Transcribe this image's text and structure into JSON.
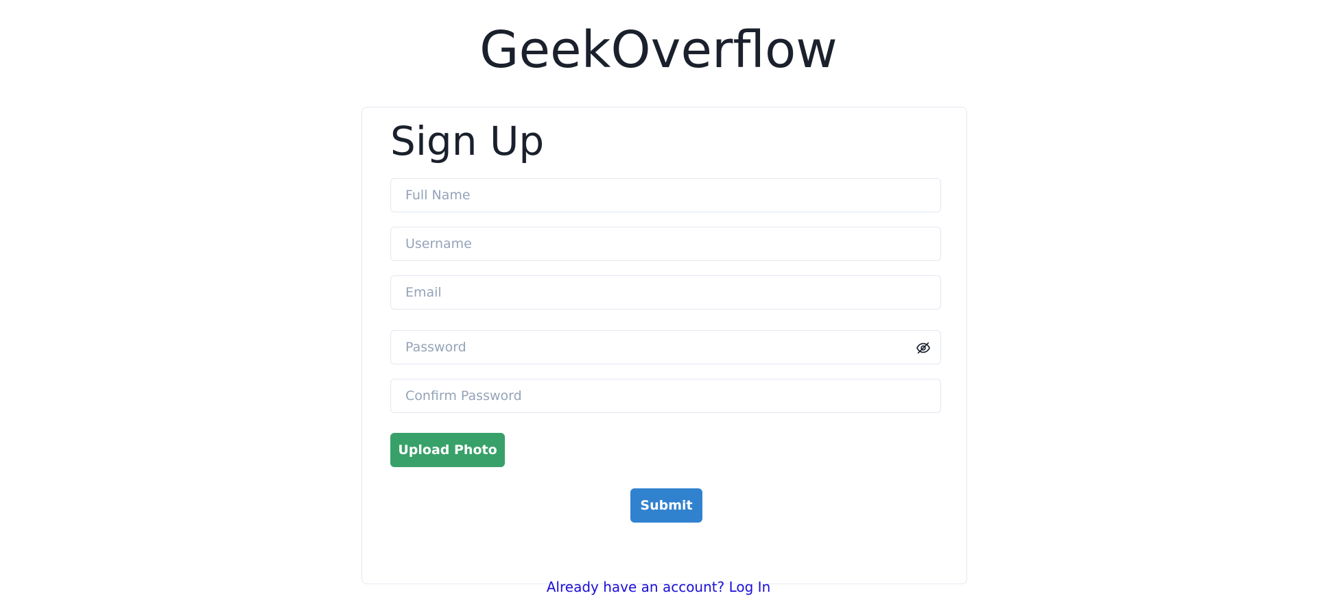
{
  "header": {
    "brand": "GeekOverflow"
  },
  "form": {
    "title": "Sign Up",
    "fields": {
      "full_name": {
        "placeholder": "Full Name",
        "value": ""
      },
      "username": {
        "placeholder": "Username",
        "value": ""
      },
      "email": {
        "placeholder": "Email",
        "value": ""
      },
      "password": {
        "placeholder": "Password",
        "value": ""
      },
      "confirm_password": {
        "placeholder": "Confirm Password",
        "value": ""
      }
    },
    "password_toggle_icon": "eye-off-icon",
    "upload_label": "Upload Photo",
    "submit_label": "Submit"
  },
  "footer": {
    "login_link": "Already have an account? Log In"
  },
  "colors": {
    "upload_button": "#38a169",
    "submit_button": "#3182ce",
    "link": "#1a0dd6",
    "text": "#1a202c",
    "placeholder": "#94a3b8",
    "border": "#e2e8f0"
  }
}
